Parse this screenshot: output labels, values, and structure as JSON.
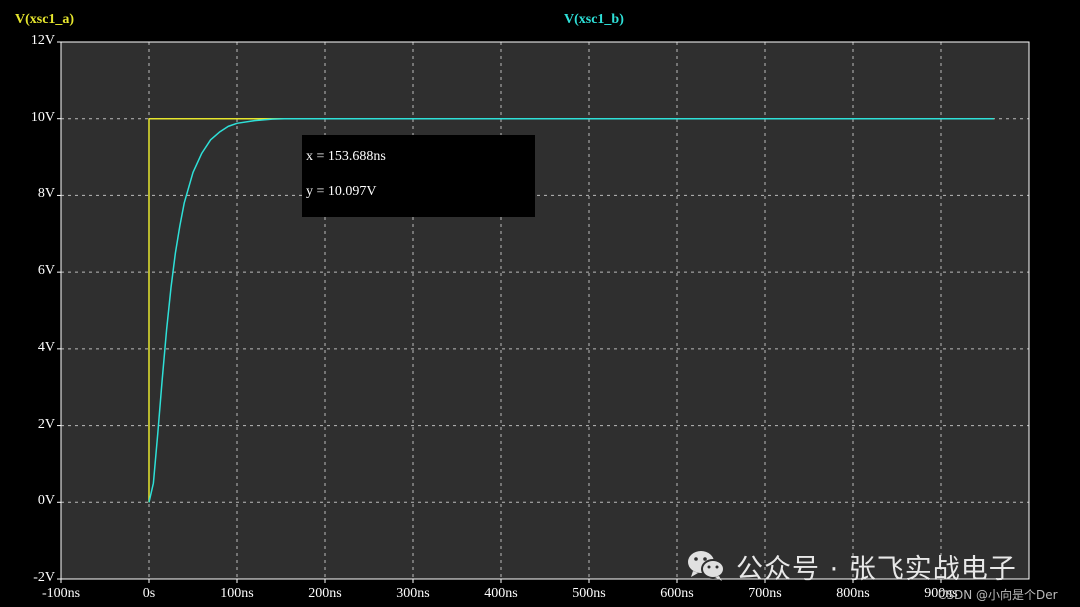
{
  "chart_data": {
    "type": "line",
    "xlabel": "",
    "ylabel": "",
    "xlim": [
      -100,
      1000
    ],
    "ylim": [
      -2,
      12
    ],
    "x_unit": "ns",
    "x_ticks": [
      -100,
      0,
      100,
      200,
      300,
      400,
      500,
      600,
      700,
      800,
      900
    ],
    "x_tick_labels": [
      "-100ns",
      "0s",
      "100ns",
      "200ns",
      "300ns",
      "400ns",
      "500ns",
      "600ns",
      "700ns",
      "800ns",
      "900ns"
    ],
    "y_ticks": [
      -2,
      0,
      2,
      4,
      6,
      8,
      10,
      12
    ],
    "y_tick_labels": [
      "-2V",
      "0V",
      "2V",
      "4V",
      "6V",
      "8V",
      "10V",
      "12V"
    ],
    "grid": true,
    "series": [
      {
        "name": "V(xsc1_a)",
        "color": "#e6e62e",
        "x": [
          0,
          0,
          50,
          100,
          150,
          200,
          300,
          400,
          500,
          600,
          700,
          800,
          900,
          960
        ],
        "y": [
          0,
          10,
          10,
          10,
          10,
          10,
          10,
          10,
          10,
          10,
          10,
          10,
          10,
          10
        ]
      },
      {
        "name": "V(xsc1_b)",
        "color": "#2ee0d8",
        "x": [
          0,
          5,
          10,
          15,
          20,
          25,
          30,
          35,
          40,
          50,
          60,
          70,
          80,
          90,
          100,
          120,
          140,
          153.688,
          170,
          200,
          300,
          400,
          500,
          600,
          700,
          800,
          900,
          960
        ],
        "y": [
          0,
          0.5,
          1.8,
          3.2,
          4.5,
          5.6,
          6.5,
          7.2,
          7.8,
          8.6,
          9.1,
          9.45,
          9.65,
          9.8,
          9.88,
          9.95,
          9.99,
          10.0,
          10.0,
          10.0,
          10.0,
          10.0,
          10.0,
          10.0,
          10.0,
          10.0,
          10.0,
          10.0
        ]
      }
    ]
  },
  "legend": {
    "a": {
      "text": "V(xsc1_a)",
      "color": "#e6e62e"
    },
    "b": {
      "text": "V(xsc1_b)",
      "color": "#2ee0d8"
    }
  },
  "cursor_readout": {
    "x": "x = 153.688ns",
    "y": "y = 10.097V"
  },
  "watermark": {
    "icon": "wechat-icon",
    "text": "公众号 · 张飞实战电子"
  },
  "csdn_credit": "CSDN @小向是个Der",
  "colors": {
    "background": "#000000",
    "plot_area": "#2f2f2f",
    "grid": "#bbbbbb"
  }
}
